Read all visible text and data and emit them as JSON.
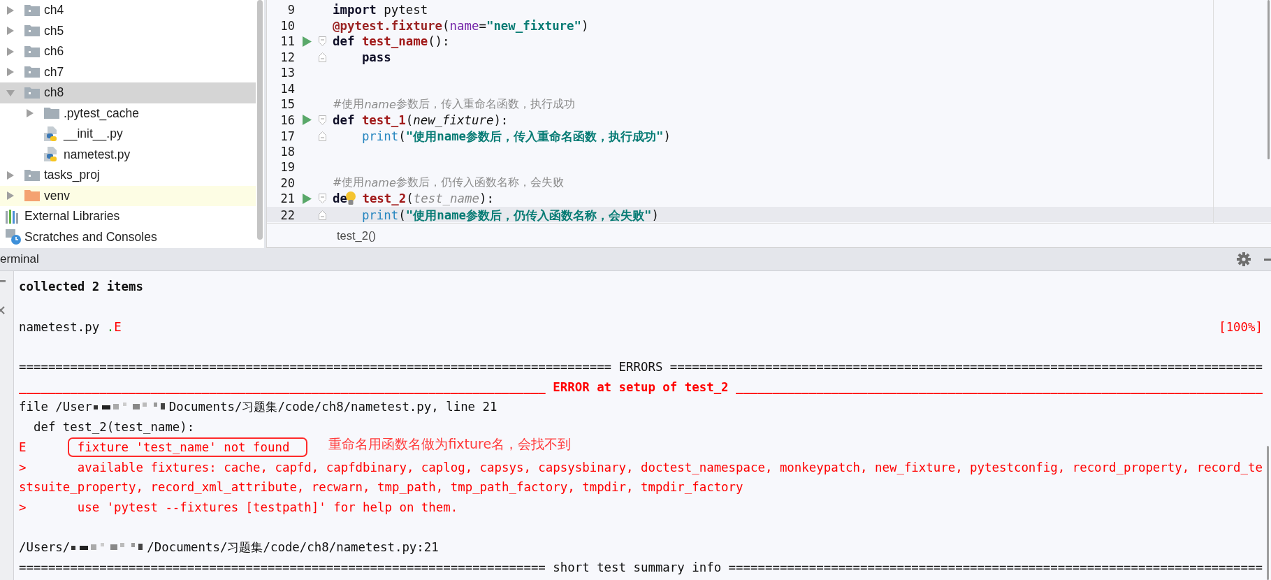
{
  "project_tree": {
    "items": [
      {
        "label": "ch4",
        "kind": "folder",
        "expanded": false,
        "selected": false
      },
      {
        "label": "ch5",
        "kind": "folder",
        "expanded": false,
        "selected": false
      },
      {
        "label": "ch6",
        "kind": "folder",
        "expanded": false,
        "selected": false
      },
      {
        "label": "ch7",
        "kind": "folder",
        "expanded": false,
        "selected": false
      },
      {
        "label": "ch8",
        "kind": "folder",
        "expanded": true,
        "selected": true,
        "children": [
          {
            "label": ".pytest_cache",
            "kind": "plain-folder",
            "expanded": false,
            "selected": false
          },
          {
            "label": "__init__.py",
            "kind": "python",
            "selected": false
          },
          {
            "label": "nametest.py",
            "kind": "python",
            "selected": false
          }
        ]
      },
      {
        "label": "tasks_proj",
        "kind": "folder",
        "expanded": false,
        "selected": false
      },
      {
        "label": "venv",
        "kind": "excluded-folder",
        "expanded": false,
        "selected": false
      },
      {
        "label": "External Libraries",
        "kind": "libraries",
        "selected": false
      },
      {
        "label": "Scratches and Consoles",
        "kind": "scratches",
        "selected": false
      }
    ]
  },
  "editor": {
    "lines": [
      {
        "number": "9",
        "run": false,
        "current": false,
        "tokens": [
          {
            "text": "import",
            "kind": "keyword"
          },
          {
            "text": " pytest",
            "kind": "plain"
          }
        ]
      },
      {
        "number": "10",
        "run": false,
        "current": false,
        "tokens": [
          {
            "text": "@pytest.fixture",
            "kind": "decorator"
          },
          {
            "text": "(",
            "kind": "plain"
          },
          {
            "text": "name",
            "kind": "kwarg"
          },
          {
            "text": "=",
            "kind": "plain"
          },
          {
            "text": "\"new_fixture\"",
            "kind": "string"
          },
          {
            "text": ")",
            "kind": "plain"
          }
        ]
      },
      {
        "number": "11",
        "run": true,
        "fold_open": true,
        "current": false,
        "tokens": [
          {
            "text": "def",
            "kind": "keyword"
          },
          {
            "text": " test_name",
            "kind": "function"
          },
          {
            "text": "():",
            "kind": "plain"
          }
        ]
      },
      {
        "number": "12",
        "run": false,
        "fold_close": true,
        "current": false,
        "tokens": [
          {
            "text": "    pass",
            "kind": "keyword"
          }
        ]
      },
      {
        "number": "13",
        "run": false,
        "current": false
      },
      {
        "number": "14",
        "run": false,
        "current": false
      },
      {
        "number": "15",
        "run": false,
        "current": false,
        "tokens": [
          {
            "text": "#使用",
            "kind": "comment"
          },
          {
            "text": "name",
            "kind": "comment-italic"
          },
          {
            "text": "参数后，传入重命名函数，执行成功",
            "kind": "comment"
          }
        ]
      },
      {
        "number": "16",
        "run": true,
        "fold_open": true,
        "current": false,
        "tokens": [
          {
            "text": "def",
            "kind": "keyword"
          },
          {
            "text": " test_1",
            "kind": "function"
          },
          {
            "text": "(",
            "kind": "plain"
          },
          {
            "text": "new_fixture",
            "kind": "param"
          },
          {
            "text": "):",
            "kind": "plain"
          }
        ]
      },
      {
        "number": "17",
        "run": false,
        "fold_close": true,
        "current": false,
        "tokens": [
          {
            "text": "    print",
            "kind": "builtin"
          },
          {
            "text": "(",
            "kind": "plain"
          },
          {
            "text": "\"使用name参数后，传入重命名函数，执行成功\"",
            "kind": "string"
          },
          {
            "text": ")",
            "kind": "plain"
          }
        ]
      },
      {
        "number": "18",
        "run": false,
        "current": false
      },
      {
        "number": "19",
        "run": false,
        "current": false
      },
      {
        "number": "20",
        "run": false,
        "current": false,
        "tokens": [
          {
            "text": "#使用",
            "kind": "comment"
          },
          {
            "text": "name",
            "kind": "comment-italic"
          },
          {
            "text": "参数后，仍传入函数名称，会失败",
            "kind": "comment"
          }
        ]
      },
      {
        "number": "21",
        "run": true,
        "fold_open": true,
        "current": false,
        "tokens": [
          {
            "text": "de",
            "kind": "keyword"
          },
          {
            "kind": "bulb"
          },
          {
            "text": " test_2",
            "kind": "function"
          },
          {
            "text": "(",
            "kind": "plain"
          },
          {
            "text": "test_name",
            "kind": "unused"
          },
          {
            "text": "):",
            "kind": "plain"
          }
        ]
      },
      {
        "number": "22",
        "run": false,
        "fold_close": true,
        "current": true,
        "tokens": [
          {
            "text": "    print",
            "kind": "builtin"
          },
          {
            "text": "(",
            "kind": "plain"
          },
          {
            "text": "\"使用name参数后，仍传入函数名称，会失败\"",
            "kind": "string"
          },
          {
            "text": ")",
            "kind": "plain"
          }
        ]
      }
    ],
    "breadcrumb": "test_2()"
  },
  "terminal": {
    "title": "erminal",
    "lines": [
      {
        "segments": [
          {
            "text": "collected 2 items",
            "kind": "summary"
          }
        ]
      },
      {
        "blank_before": true,
        "segments": [
          {
            "text": "nametest.py ",
            "kind": "output"
          },
          {
            "text": ".",
            "kind": "pass"
          },
          {
            "text": "E",
            "kind": "error"
          }
        ],
        "right": {
          "text": "[100%]",
          "kind": "error"
        }
      },
      {
        "blank_before": true,
        "segments": [
          {
            "text": "================================================================================= ERRORS =================================================================================",
            "kind": "output"
          }
        ]
      },
      {
        "segments": [
          {
            "text": "________________________________________________________________________ ERROR at setup of test_2 ________________________________________________________________________",
            "kind": "error-header"
          }
        ]
      },
      {
        "segments": [
          {
            "text": "file /User",
            "kind": "output"
          },
          {
            "kind": "redacted"
          },
          {
            "text": "Documents/习题集/code/ch8/nametest.py, line 21",
            "kind": "output"
          }
        ]
      },
      {
        "segments": [
          {
            "text": "  def test_2(test_name):",
            "kind": "output"
          }
        ]
      },
      {
        "segments": [
          {
            "text": "E       ",
            "kind": "error"
          },
          {
            "text": "fixture 'test_name' not found",
            "kind": "error",
            "boxed": true
          }
        ],
        "note": "重命名用函数名做为fixture名，会找不到"
      },
      {
        "segments": [
          {
            "text": ">       available fixtures: cache, capfd, capfdbinary, caplog, capsys, capsysbinary, doctest_namespace, monkeypatch, new_fixture, pytestconfig, record_property, record_te",
            "kind": "error"
          }
        ]
      },
      {
        "segments": [
          {
            "text": "stsuite_property, record_xml_attribute, recwarn, tmp_path, tmp_path_factory, tmpdir, tmpdir_factory",
            "kind": "error"
          }
        ]
      },
      {
        "segments": [
          {
            "text": ">       use 'pytest --fixtures [testpath]' for help on them.",
            "kind": "error"
          }
        ]
      },
      {
        "blank_before": true,
        "segments": [
          {
            "text": "/Users/",
            "kind": "output"
          },
          {
            "kind": "redacted"
          },
          {
            "text": "/Documents/习题集/code/ch8/nametest.py:21",
            "kind": "output"
          }
        ]
      },
      {
        "segments": [
          {
            "text": "======================================================================== short test summary info =========================================================================",
            "kind": "output"
          }
        ]
      }
    ]
  }
}
